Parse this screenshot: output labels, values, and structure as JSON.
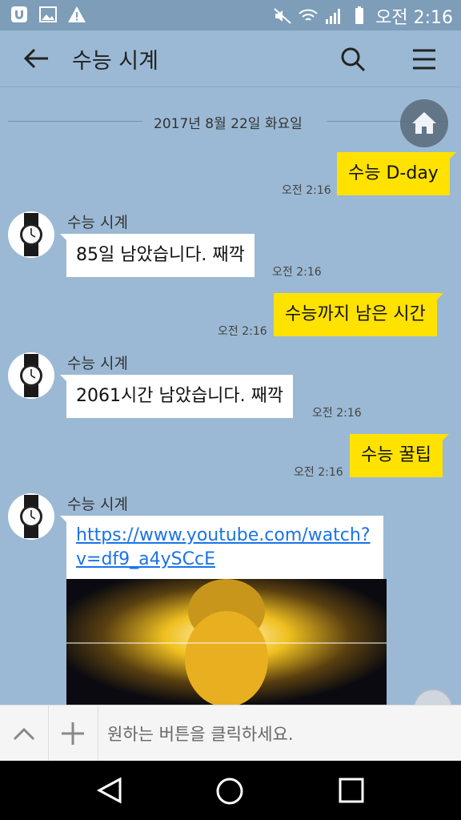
{
  "status_bar": {
    "time": "오전 2:16",
    "icons": [
      "app-icon",
      "image-icon",
      "warning-icon",
      "mute-icon",
      "wifi-icon",
      "signal-icon",
      "battery-icon"
    ]
  },
  "app_bar": {
    "title": "수능 시계",
    "icons": [
      "back-arrow-icon",
      "search-icon",
      "menu-icon"
    ]
  },
  "date_separator": "2017년 8월 22일 화요일",
  "messages": [
    {
      "from": "me",
      "text": "수능 D-day",
      "time": "오전 2:16"
    },
    {
      "from": "bot",
      "sender": "수능 시계",
      "text": "85일 남았습니다. 째깍",
      "time": "오전 2:16"
    },
    {
      "from": "me",
      "text": "수능까지 남은 시간",
      "time": "오전 2:16"
    },
    {
      "from": "bot",
      "sender": "수능 시계",
      "text": "2061시간 남았습니다. 째깍",
      "time": "오전 2:16"
    },
    {
      "from": "me",
      "text": "수능 꿀팁",
      "time": "오전 2:16"
    },
    {
      "from": "bot",
      "sender": "수능 시계",
      "link": "https://www.youtube.com/watch?v=df9_a4ySCcE"
    }
  ],
  "input_bar": {
    "placeholder": "원하는 버튼을 클릭하세요."
  },
  "colors": {
    "background": "#9bb9d4",
    "my_bubble": "#ffe200",
    "bot_bubble": "#ffffff",
    "link": "#1a73e8"
  }
}
